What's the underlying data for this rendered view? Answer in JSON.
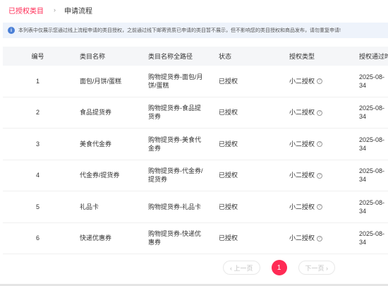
{
  "breadcrumb": {
    "active": "已授权类目",
    "separator": "›",
    "current": "申请流程"
  },
  "notice": {
    "icon": "i",
    "text": "本列表中仅展示您通过线上流程申请的类目授权，之前通过线下邮寄资质已申请的类目暂不展示，但不影响您的类目授权和商品发布，请勿重复申请!"
  },
  "table": {
    "headers": [
      "编号",
      "类目名称",
      "类目名称全路径",
      "状态",
      "授权类型",
      "授权通过时"
    ],
    "rows": [
      {
        "id": "1",
        "name": "面包/月饼/蛋糕",
        "path": "购物提货券-面包/月饼/蛋糕",
        "status": "已授权",
        "type": "小二授权",
        "time": "2025-08-34"
      },
      {
        "id": "2",
        "name": "食品提货券",
        "path": "购物提货券-食品提货券",
        "status": "已授权",
        "type": "小二授权",
        "time": "2025-08-34"
      },
      {
        "id": "3",
        "name": "美食代金券",
        "path": "购物提货券-美食代金券",
        "status": "已授权",
        "type": "小二授权",
        "time": "2025-08-34"
      },
      {
        "id": "4",
        "name": "代金券/提货券",
        "path": "购物提货券-代金券/提货券",
        "status": "已授权",
        "type": "小二授权",
        "time": "2025-08-34"
      },
      {
        "id": "5",
        "name": "礼品卡",
        "path": "购物提货券-礼品卡",
        "status": "已授权",
        "type": "小二授权",
        "time": "2025-08-34"
      },
      {
        "id": "6",
        "name": "快递优惠券",
        "path": "购物提货券-快递优惠券",
        "status": "已授权",
        "type": "小二授权",
        "time": "2025-08-34"
      }
    ],
    "help_icon": "?"
  },
  "pagination": {
    "prev": "‹ 上一页",
    "current": "1",
    "next": "下一页 ›"
  },
  "colors": {
    "accent": "#ff2b55",
    "info": "#4a7fd6",
    "notice_bg": "#eef3fb",
    "header_bg": "#f5f6f8"
  }
}
